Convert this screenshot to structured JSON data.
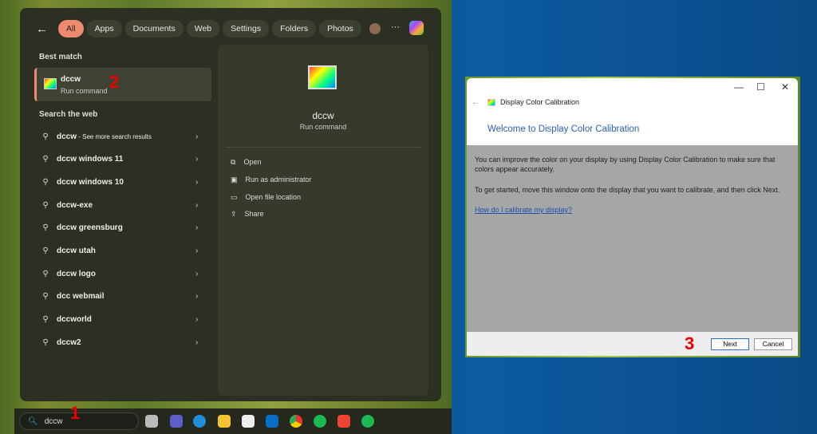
{
  "start": {
    "filters": [
      "All",
      "Apps",
      "Documents",
      "Web",
      "Settings",
      "Folders",
      "Photos"
    ],
    "best_match_heading": "Best match",
    "best": {
      "title": "dccw",
      "subtitle": "Run command"
    },
    "web_heading": "Search the web",
    "web_items": [
      {
        "bold": "dccw",
        "rest": " - See more search results"
      },
      {
        "bold": "dccw windows 11",
        "rest": ""
      },
      {
        "bold": "dccw windows 10",
        "rest": ""
      },
      {
        "bold": "dccw-exe",
        "rest": ""
      },
      {
        "bold": "dccw greensburg",
        "rest": ""
      },
      {
        "bold": "dccw utah",
        "rest": ""
      },
      {
        "bold": "dccw logo",
        "rest": ""
      },
      {
        "bold": "dcc webmail",
        "rest": ""
      },
      {
        "bold": "dccworld",
        "rest": ""
      },
      {
        "bold": "dccw2",
        "rest": ""
      }
    ],
    "detail": {
      "title": "dccw",
      "subtitle": "Run command",
      "actions": [
        "Open",
        "Run as administrator",
        "Open file location",
        "Share"
      ]
    }
  },
  "taskbar": {
    "search_value": "dccw"
  },
  "steps": [
    "1",
    "2",
    "3"
  ],
  "dialog": {
    "title": "Display Color Calibration",
    "heading": "Welcome to Display Color Calibration",
    "para1": "You can improve the color on your display by using Display Color Calibration to make sure that colors appear accurately.",
    "para2": "To get started, move this window onto the display that you want to calibrate, and then click Next.",
    "link": "How do I calibrate my display?",
    "next": "Next",
    "cancel": "Cancel"
  },
  "colors": {
    "accent": "#ef8a70",
    "link": "#2b5fb8",
    "step": "#e00000"
  }
}
